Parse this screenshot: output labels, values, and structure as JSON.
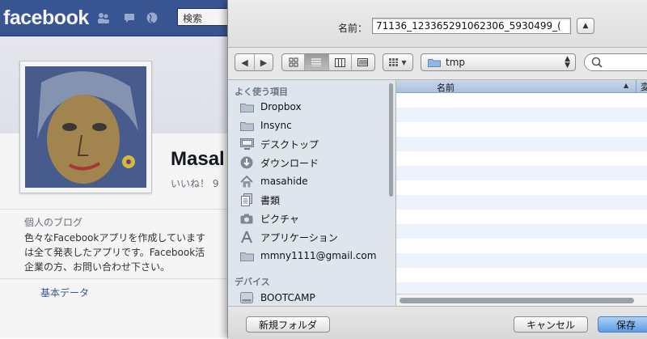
{
  "facebook": {
    "logo": "facebook",
    "search_placeholder": "検索",
    "profile_name": "Masal",
    "likes_text": "いいね！ 9",
    "blog_title": "個人のブログ",
    "blog_text_1": "色々なFacebookアプリを作成しています",
    "blog_text_2": "は全て発表したアプリです。Facebook活",
    "blog_text_3": "企業の方、お問い合わせ下さい。",
    "basic_data": "基本データ",
    "brand_color": "#3b5998"
  },
  "dialog": {
    "name_label": "名前：",
    "filename": "71136_123365291062306_5930499_(",
    "location": "tmp",
    "sidebar": {
      "favorites_header": "よく使う項目",
      "devices_header": "デバイス",
      "favorites": [
        {
          "label": "Dropbox",
          "icon": "folder-icon"
        },
        {
          "label": "Insync",
          "icon": "folder-icon"
        },
        {
          "label": "デスクトップ",
          "icon": "desktop-icon"
        },
        {
          "label": "ダウンロード",
          "icon": "download-icon"
        },
        {
          "label": "masahide",
          "icon": "home-icon"
        },
        {
          "label": "書類",
          "icon": "documents-icon"
        },
        {
          "label": "ピクチャ",
          "icon": "camera-icon"
        },
        {
          "label": "アプリケーション",
          "icon": "applications-icon"
        },
        {
          "label": "mmny1111@gmail.com",
          "icon": "folder-icon"
        }
      ],
      "devices": [
        {
          "label": "BOOTCAMP",
          "icon": "disk-icon"
        }
      ]
    },
    "columns": {
      "name": "名前",
      "second": "変"
    },
    "buttons": {
      "new_folder": "新規フォルダ",
      "cancel": "キャンセル",
      "save": "保存"
    }
  }
}
